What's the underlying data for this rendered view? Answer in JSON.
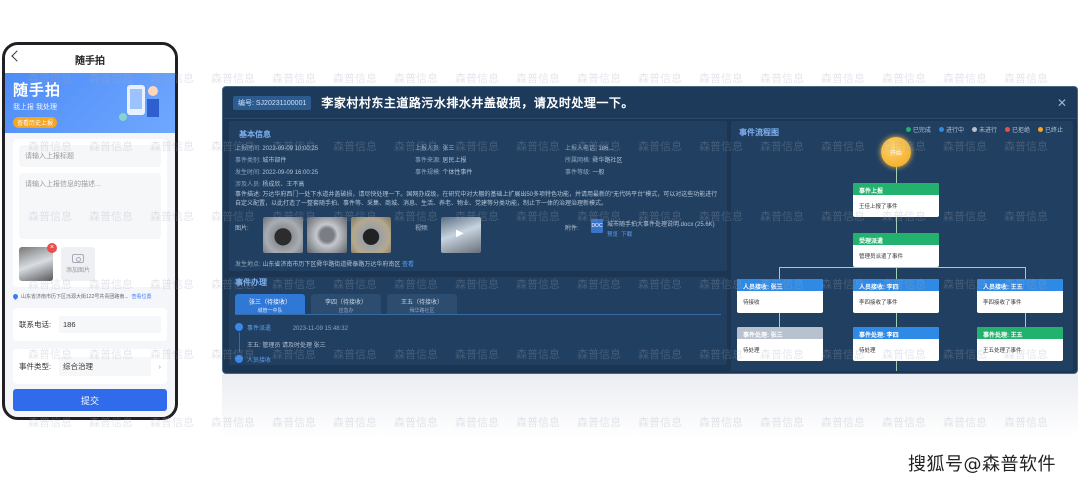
{
  "watermark": "森普信息",
  "footer_brand": "搜狐号@森普软件",
  "phone": {
    "title": "随手拍",
    "banner_title": "随手拍",
    "banner_subtitle": "我上报 我处理",
    "banner_badge": "查看历史上报",
    "title_placeholder": "请输入上报标题",
    "desc_placeholder": "请输入上报信息的描述...",
    "add_photo_label": "添加图片",
    "location_text": "山东省济南市历下区泺源大街122号共青团路南...",
    "location_link": "查看位置",
    "phone_label": "联系电话:",
    "phone_value": "186",
    "type_label": "事件类型:",
    "type_value": "综合治理",
    "submit_label": "提交"
  },
  "dash": {
    "event_no": "编号: SJ20231100001",
    "title": "李家村村东主道路污水排水井盖破损，请及时处理一下。",
    "close": "✕",
    "basic_title": "基本信息",
    "fields": [
      {
        "k": "上报时间:",
        "v": "2022-09-09 10:00:25"
      },
      {
        "k": "上报人员:",
        "v": "张三"
      },
      {
        "k": "上报人电话:",
        "v": "186..."
      },
      {
        "k": "事件类别:",
        "v": "城市部件"
      },
      {
        "k": "事件来源:",
        "v": "居民上报"
      },
      {
        "k": "所属网格:",
        "v": "舜华路社区"
      },
      {
        "k": "发生时间:",
        "v": "2022-09-09 16:00:25"
      },
      {
        "k": "事件规模:",
        "v": "个体性事件"
      },
      {
        "k": "事件等级:",
        "v": "一般"
      },
      {
        "k": "涉及人员:",
        "v": "杨成欣、王不高"
      }
    ],
    "desc_label": "事件描述:",
    "desc_text": "万达华府西门一处下水道井盖破损，请尽快处理一下。国网办成级，在研究中对大棚的基础上扩展出50多项特色功能，并请用最新的\"无代码平台\"模式，可以对这些功能进行自定义配置，以此打造了一整套随手拍、事件等、采集、商城、消息、生活、养老、物业、党建等分类功能，制止下一体的治理治理新模式。",
    "attach_label": "图片:",
    "video_label": "视频:",
    "file_label": "附件:",
    "file_ext": "DOC",
    "file_name": "城市随手拍大事件处理说明.docx (25.6K)",
    "file_preview": "预览",
    "file_download": "下载",
    "addr_label": "发生地点:",
    "addr_text": "山东省济南市历下区舜华路街道舜泰路万达华府南区",
    "addr_link": "查看",
    "handle_title": "事件办理",
    "tabs": [
      {
        "name": "张三（待接收）",
        "sub": "城管一中队"
      },
      {
        "name": "李四（待接收）",
        "sub": "应急办"
      },
      {
        "name": "王五（待接收）",
        "sub": "舜华路社区"
      }
    ],
    "log_status": "事件派遣",
    "log_time": "2023-11-09 15:48:32",
    "log_body": "王五: 管理员 请及时处理 张三",
    "log2_status": "人员接收",
    "flow_title": "事件流程图",
    "legend": [
      {
        "label": "已完成",
        "color": "#23b26d"
      },
      {
        "label": "进行中",
        "color": "#2f8ae6"
      },
      {
        "label": "未进行",
        "color": "#b8c2ce"
      },
      {
        "label": "已拒绝",
        "color": "#e94e4e"
      },
      {
        "label": "已终止",
        "color": "#f5a623"
      }
    ],
    "flow_start": "开始",
    "node_report_title": "事件上报",
    "node_report_body": "王佳上报了事件",
    "node_dispatch_title": "受理派遣",
    "node_dispatch_body": "管理员派遣了事件",
    "node_recv1_title": "人员接收: 张三",
    "node_recv1_body": "待接收",
    "node_recv2_title": "人员接收: 李四",
    "node_recv2_body": "李四接收了事件",
    "node_recv3_title": "人员接收: 王五",
    "node_recv3_body": "李四接收了事件",
    "node_proc1_title": "事件处理: 张三",
    "node_proc1_body": "待处理",
    "node_proc2_title": "事件处理: 李四",
    "node_proc2_body": "待处理",
    "node_proc3_title": "事件处理: 王五",
    "node_proc3_body": "王五处理了事件"
  }
}
